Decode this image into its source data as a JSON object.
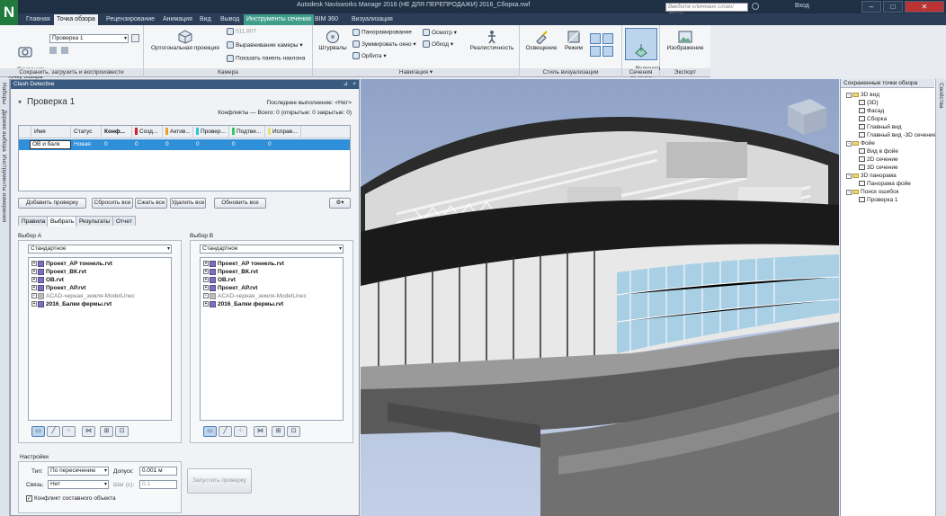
{
  "window": {
    "title": "Autodesk Navisworks Manage 2016 (НЕ ДЛЯ ПЕРЕПРОДАЖИ)     2016_Сборка.nwf",
    "logo": "N",
    "search_placeholder": "Введите ключевое слово/фразу",
    "signin": "Вход",
    "controls": [
      "–",
      "□",
      "✕"
    ]
  },
  "tabs": [
    "Главная",
    "Точка обзора",
    "Рецензирование",
    "Анимация",
    "Вид",
    "Вывод",
    "Инструменты сечения",
    "BIM 360",
    "Визуализация"
  ],
  "ribbon": {
    "save_group": {
      "save_label": "Сохранить\nточку обзора",
      "current_view": "Проверка 1",
      "name": "Сохранить, загрузить и воспроизвести"
    },
    "camera_group": {
      "ortho": "Ортогональная проекция",
      "fov_value": "011.807",
      "align": "Выравнивание камеры",
      "show_tilt": "Показать панель наклона",
      "name": "Камера"
    },
    "nav_group": {
      "wheels": "Штурвалы",
      "pan": "Панорамирование",
      "zoom": "Зуммировать окно",
      "orbit": "Орбита",
      "look": "Осмотр",
      "walk": "Обход",
      "realism": "Реалистичность",
      "name": "Навигация"
    },
    "style_group": {
      "lighting": "Освещение",
      "mode": "Режим",
      "name": "Стиль визуализации"
    },
    "section_group": {
      "enable": "Включить\nсечение",
      "name": "Сечения"
    },
    "export_group": {
      "image": "Изображение",
      "name": "Экспорт"
    }
  },
  "clash": {
    "panel_title": "Clash Detective",
    "test_name": "Проверка 1",
    "last_run": "Последнее выполнение: <Нет>",
    "conflicts": "Конфликты — Всего: 0 (открытые: 0  закрытые: 0)",
    "columns": [
      {
        "label": "Имя",
        "color": ""
      },
      {
        "label": "Статус",
        "color": ""
      },
      {
        "label": "Конф...",
        "color": ""
      },
      {
        "label": "Созд...",
        "color": "#d21f2a"
      },
      {
        "label": "Актив...",
        "color": "#f0a020"
      },
      {
        "label": "Провер...",
        "color": "#30c8d8"
      },
      {
        "label": "Подтве...",
        "color": "#30c860"
      },
      {
        "label": "Исправ...",
        "color": "#e8e070"
      }
    ],
    "row": {
      "name": "ОВ и балк",
      "status": "Новая",
      "values": [
        "0",
        "0",
        "0",
        "0",
        "0",
        "0"
      ]
    },
    "buttons": {
      "add": "Добавить проверку",
      "reset": "Сбросить все",
      "compact": "Сжать все",
      "delete": "Удалить все",
      "update": "Обновить все"
    },
    "tabs": [
      "Правила",
      "Выбрать",
      "Результаты",
      "Отчет"
    ],
    "selection_a": {
      "label": "Выбор A",
      "mode": "Стандартное",
      "items": [
        {
          "name": "Проект_АР тоннель.rvt",
          "style": "bold"
        },
        {
          "name": "Проект_ВК.rvt",
          "style": "bold"
        },
        {
          "name": "ОВ.rvt",
          "style": "bold"
        },
        {
          "name": "Проект_АР.rvt",
          "style": "bold"
        },
        {
          "name": "ACAD-черная_земля-ModelLinec",
          "style": "grey"
        },
        {
          "name": "2016_Балки фермы.rvt",
          "style": "bold"
        }
      ]
    },
    "selection_b": {
      "label": "Выбор B",
      "mode": "Стандартное",
      "items": [
        {
          "name": "Проект_АР тоннель.rvt",
          "style": "bold"
        },
        {
          "name": "Проект_ВК.rvt",
          "style": "bold"
        },
        {
          "name": "ОВ.rvt",
          "style": "bold"
        },
        {
          "name": "Проект_АР.rvt",
          "style": "bold"
        },
        {
          "name": "ACAD-черная_земля-ModelLinec",
          "style": "grey"
        },
        {
          "name": "2016_Балки фермы.rvt",
          "style": "bold"
        }
      ]
    },
    "settings": {
      "label": "Настройки",
      "type_label": "Тип:",
      "type_value": "По пересечению",
      "tolerance_label": "Допуск:",
      "tolerance_value": "0.001 м",
      "link_label": "Связь:",
      "link_value": "Нет",
      "step_label": "Шаг (с):",
      "step_value": "0.1",
      "composite": "Конфликт составного объекта",
      "run_button": "Запустить проверку"
    }
  },
  "left_strip": [
    "Наборы",
    "Дерево выбора",
    "Инструменты измерения"
  ],
  "viewpoints": {
    "title": "Сохраненные точки обзора",
    "items": [
      {
        "label": "3D вид",
        "level": 1,
        "type": "folder"
      },
      {
        "label": "{3D}",
        "level": 2,
        "type": "view"
      },
      {
        "label": "Фасад",
        "level": 2,
        "type": "view"
      },
      {
        "label": "Сборка",
        "level": 2,
        "type": "view"
      },
      {
        "label": "Главный вид",
        "level": 2,
        "type": "view"
      },
      {
        "label": "Главный вид -3D сечение",
        "level": 2,
        "type": "view"
      },
      {
        "label": "Фойе",
        "level": 1,
        "type": "folder"
      },
      {
        "label": "Вид в фойе",
        "level": 2,
        "type": "view"
      },
      {
        "label": "2D сечение",
        "level": 2,
        "type": "view"
      },
      {
        "label": "3D сечение",
        "level": 2,
        "type": "view"
      },
      {
        "label": "3D панорама",
        "level": 1,
        "type": "folder"
      },
      {
        "label": "Панорама фойе",
        "level": 2,
        "type": "view"
      },
      {
        "label": "Поиск ошибок",
        "level": 1,
        "type": "folder"
      },
      {
        "label": "Проверка 1",
        "level": 2,
        "type": "view"
      }
    ],
    "side_tab": "Свойства"
  }
}
